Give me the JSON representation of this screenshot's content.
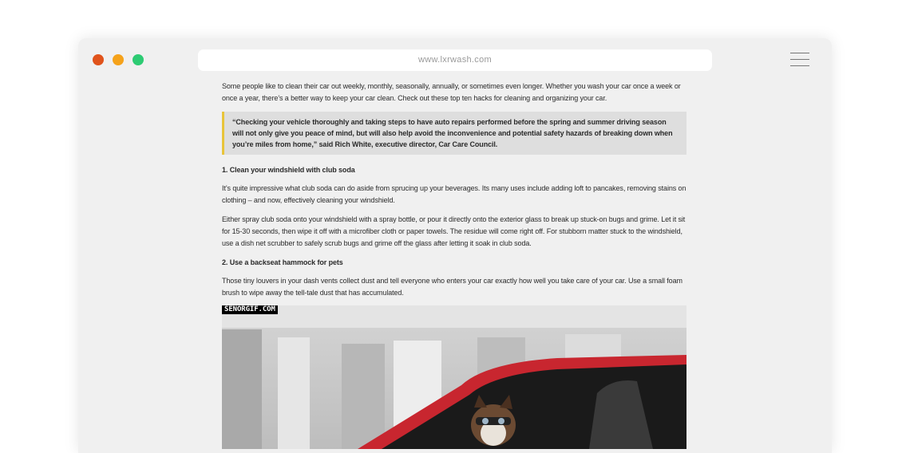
{
  "browser": {
    "url": "www.lxrwash.com",
    "window_controls": [
      "close",
      "minimize",
      "maximize"
    ],
    "menu_icon": "hamburger-menu-icon"
  },
  "article": {
    "intro": "Some people like to clean their car out weekly, monthly, seasonally, annually, or sometimes even longer. Whether you wash your car once a week or once a year, there’s a better way to keep your car clean. Check out these top ten hacks for cleaning and organizing your car.",
    "quote": "“Checking your vehicle thoroughly and taking steps to have auto repairs performed before the spring and summer driving season will not only give you peace of mind, but will also help avoid the inconvenience and potential safety hazards of breaking down when you’re miles from home,” said Rich White, executive director, Car Care Council.",
    "sections": [
      {
        "heading": "1. Clean your windshield with club soda",
        "paragraphs": [
          "It’s quite impressive what club soda can do aside from sprucing up your beverages. Its many uses include adding loft to pancakes, removing stains on clothing – and now, effectively cleaning your windshield.",
          "Either spray club soda onto your windshield with a spray bottle, or pour it directly onto the exterior glass to break up stuck-on bugs and grime. Let it sit for 15-30 seconds, then wipe it off with a microfiber cloth or paper towels. The residue will come right off. For stubborn matter stuck to the windshield, use a dish net scrubber to safely scrub bugs and grime off the glass after letting it soak in club soda."
        ]
      },
      {
        "heading": "2. Use a backseat hammock for pets",
        "paragraphs": [
          "Those tiny louvers in your dash vents collect dust and tell everyone who enters your car exactly how well you take care of your car. Use a small foam brush to wipe away the tell-tale dust that has accumulated."
        ]
      }
    ],
    "image": {
      "watermark": "SENORGIF.COM",
      "description_icon": "dog-in-car-image"
    }
  },
  "colors": {
    "close_dot": "#e0531b",
    "minimize_dot": "#f5a21b",
    "maximize_dot": "#2dcb73",
    "quote_border": "#e8c43a",
    "car_red": "#c8262f"
  }
}
